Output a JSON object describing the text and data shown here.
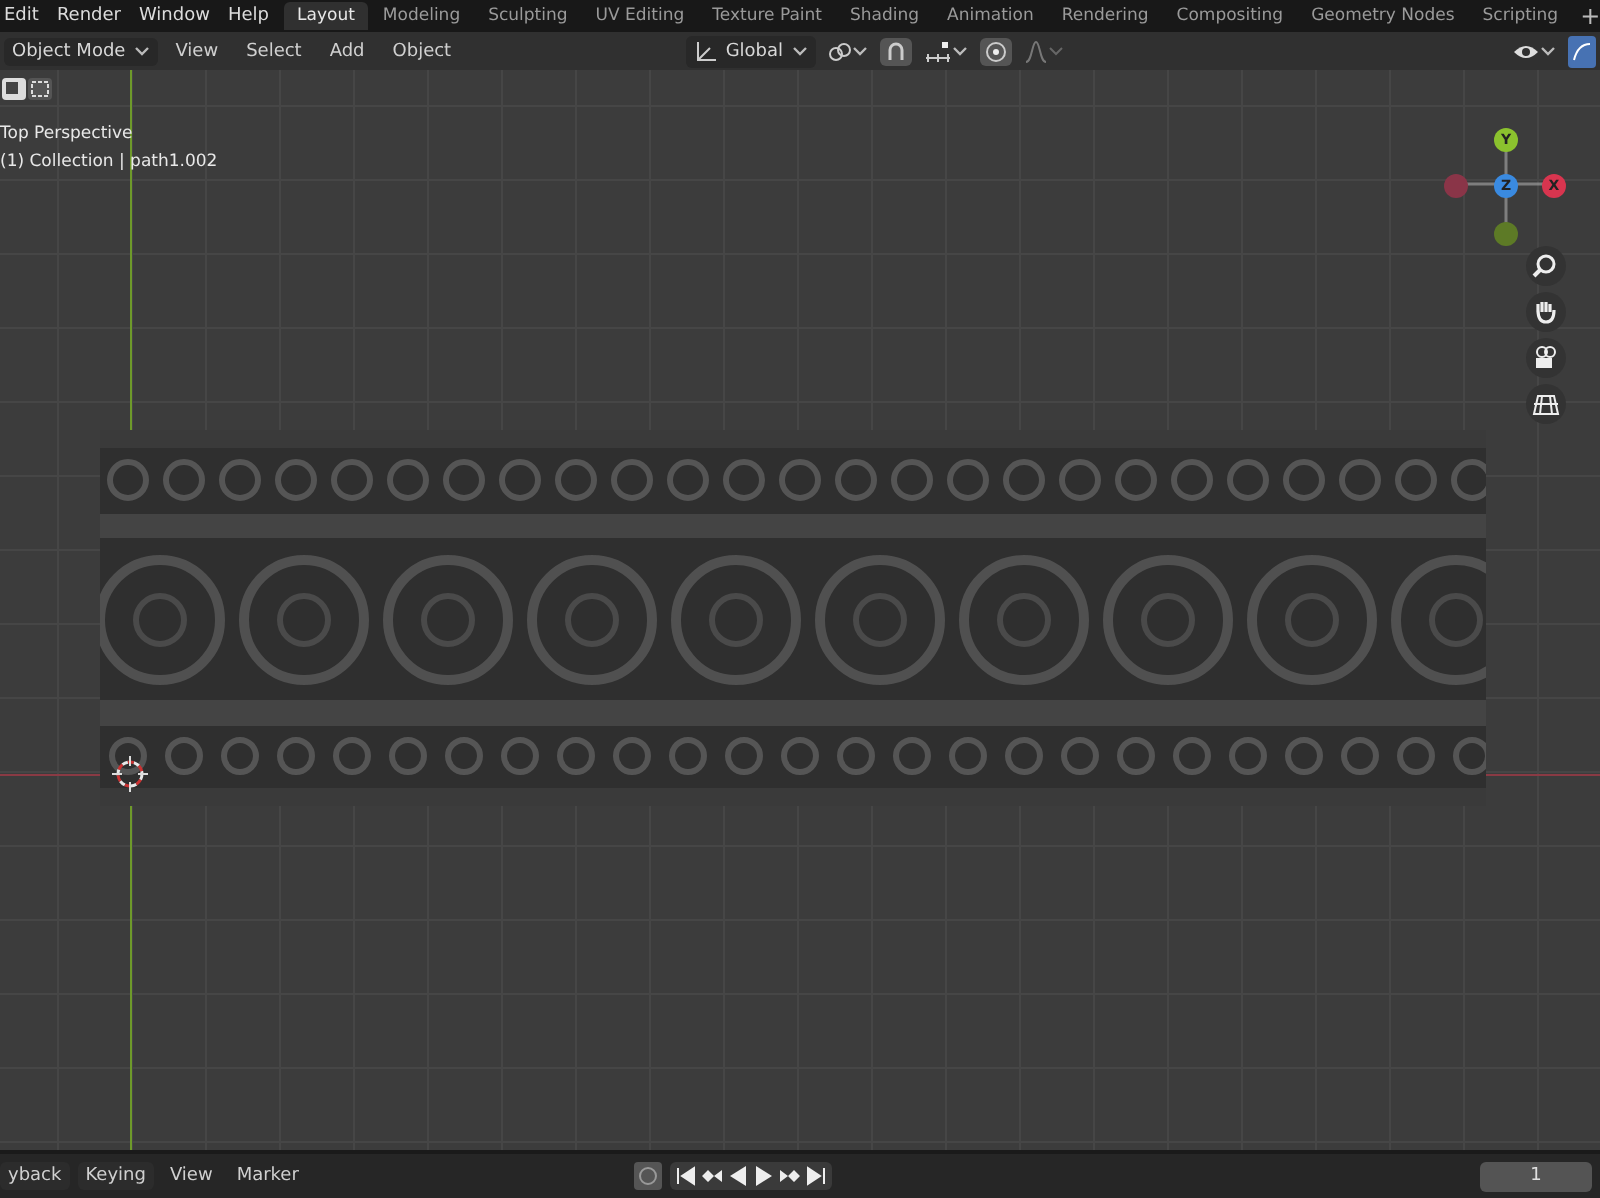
{
  "menu": [
    "Edit",
    "Render",
    "Window",
    "Help"
  ],
  "workspaces": [
    {
      "label": "Layout",
      "selected": true
    },
    {
      "label": "Modeling",
      "selected": false
    },
    {
      "label": "Sculpting",
      "selected": false
    },
    {
      "label": "UV Editing",
      "selected": false
    },
    {
      "label": "Texture Paint",
      "selected": false
    },
    {
      "label": "Shading",
      "selected": false
    },
    {
      "label": "Animation",
      "selected": false
    },
    {
      "label": "Rendering",
      "selected": false
    },
    {
      "label": "Compositing",
      "selected": false
    },
    {
      "label": "Geometry Nodes",
      "selected": false
    },
    {
      "label": "Scripting",
      "selected": false
    }
  ],
  "add_workspace": "+",
  "header": {
    "mode": "Object Mode",
    "menus": [
      "View",
      "Select",
      "Add",
      "Object"
    ],
    "orientation": "Global",
    "snap": {
      "on": true
    },
    "proportional_editing": {
      "on": true
    }
  },
  "viewport": {
    "view_name": "Top Perspective",
    "object_info": "(1) Collection | path1.002",
    "gizmo": {
      "y": "Y",
      "z": "Z",
      "x": "X"
    }
  },
  "timeline": {
    "menus": [
      {
        "label": "yback",
        "kind": "dropdown"
      },
      {
        "label": "Keying",
        "kind": "dropdown"
      },
      {
        "label": "View",
        "kind": "plain"
      },
      {
        "label": "Marker",
        "kind": "plain"
      }
    ],
    "current_frame": "1"
  }
}
